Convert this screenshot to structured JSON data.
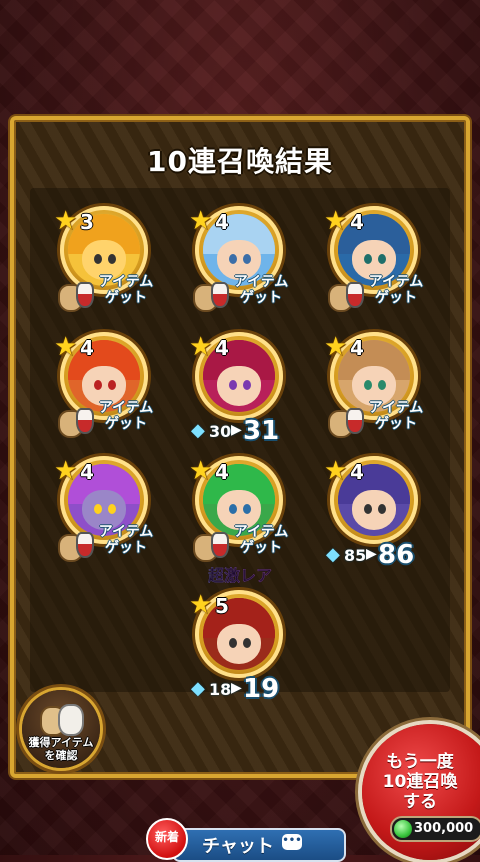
{
  "title": "10連召喚結果",
  "colors": {
    "frame_gold": "#d8a631",
    "panel_brown": "#3d2a12",
    "accent_red": "#c41919",
    "level_blue": "#7ee0ff"
  },
  "results": [
    {
      "stars": 3,
      "status": "item",
      "item_line1": "アイテム",
      "item_line2": "ゲット"
    },
    {
      "stars": 4,
      "status": "item",
      "item_line1": "アイテム",
      "item_line2": "ゲット"
    },
    {
      "stars": 4,
      "status": "item",
      "item_line1": "アイテム",
      "item_line2": "ゲット"
    },
    {
      "stars": 4,
      "status": "item",
      "item_line1": "アイテム",
      "item_line2": "ゲット"
    },
    {
      "stars": 4,
      "status": "level",
      "level_old": "30",
      "level_new": "31"
    },
    {
      "stars": 4,
      "status": "item",
      "item_line1": "アイテム",
      "item_line2": "ゲット"
    },
    {
      "stars": 4,
      "status": "item",
      "item_line1": "アイテム",
      "item_line2": "ゲット"
    },
    {
      "stars": 4,
      "status": "item",
      "item_line1": "アイテム",
      "item_line2": "ゲット"
    },
    {
      "stars": 4,
      "status": "level",
      "level_old": "85",
      "level_new": "86"
    },
    {
      "stars": 5,
      "status": "level",
      "level_old": "18",
      "level_new": "19",
      "label": "超激レア"
    }
  ],
  "confirm_button": {
    "line1": "獲得アイテム",
    "line2": "を確認"
  },
  "retry_button": {
    "line1": "もう一度",
    "line2": "10連召喚",
    "line3": "する",
    "cost": "300,000"
  },
  "chat": {
    "label": "チャット",
    "badge": "新着"
  }
}
